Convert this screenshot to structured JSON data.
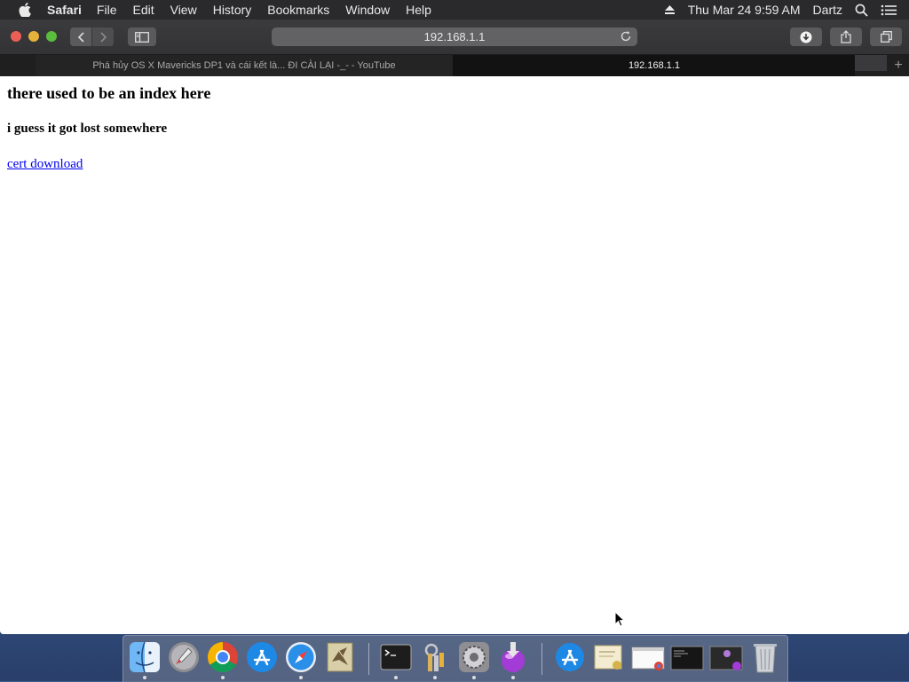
{
  "menubar": {
    "app_name": "Safari",
    "menus": [
      "File",
      "Edit",
      "View",
      "History",
      "Bookmarks",
      "Window",
      "Help"
    ],
    "clock": "Thu Mar 24  9:59 AM",
    "user": "Dartz"
  },
  "browser": {
    "url": "192.168.1.1",
    "tabs": [
      {
        "title": "Phá hủy OS X Mavericks DP1 và cái kết là... ĐI CÀI LẠI -_- - YouTube",
        "active": false
      },
      {
        "title": "192.168.1.1",
        "active": true
      }
    ],
    "new_tab_label": "+"
  },
  "page": {
    "heading": "there used to be an index here",
    "subheading": "i guess it got lost somewhere",
    "link_text": "cert download"
  },
  "dock": {
    "apps": [
      "finder-icon",
      "launchpad-icon",
      "chrome-icon",
      "app-store-icon",
      "safari-icon",
      "mail-eagle-icon",
      "terminal-icon",
      "keychain-icon",
      "system-preferences-icon",
      "installer-icon"
    ],
    "others": [
      "app-store-doc-icon",
      "certificate-icon",
      "chrome-window-icon",
      "terminal-window-icon",
      "installer-window-icon",
      "trash-icon"
    ]
  }
}
